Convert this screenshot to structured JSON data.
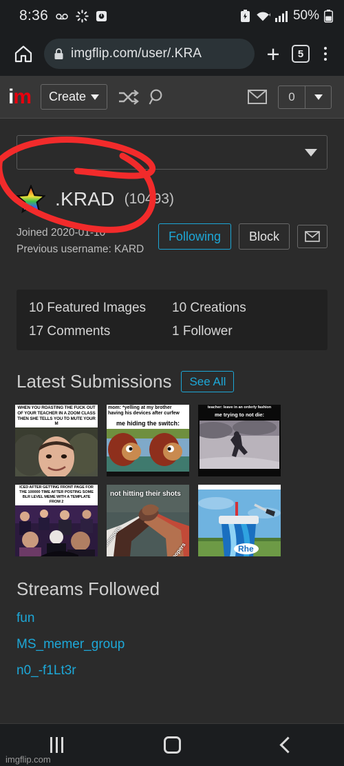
{
  "statusbar": {
    "time": "8:36",
    "battery_percent": "50%",
    "icons": [
      "voicemail-icon",
      "loading-spinner-icon",
      "screen-record-icon",
      "battery-saver-icon",
      "wifi-icon",
      "signal-icon",
      "battery-icon"
    ]
  },
  "browser": {
    "url_visible": "imgflip.com/user/.KRA",
    "url_domain": "imgflip.com",
    "url_path": "/user/.KRA",
    "tab_count": "5",
    "home_icon": "home-icon",
    "lock_icon": "lock-icon",
    "new_tab_icon": "plus-icon",
    "menu_icon": "kebab-menu-icon"
  },
  "site_header": {
    "logo_i": "i",
    "logo_m": "m",
    "create_label": "Create",
    "shuffle_icon": "shuffle-icon",
    "search_icon": "search-icon",
    "mail_icon": "envelope-icon",
    "notification_count": "0"
  },
  "profile": {
    "dropdown_value": "",
    "avatar_icon": "rainbow-star-avatar",
    "username": ".KRAD",
    "points": "(10493)",
    "joined": "Joined 2020-01-10",
    "previous_username": "Previous username: KARD",
    "following_label": "Following",
    "block_label": "Block",
    "message_icon": "envelope-icon"
  },
  "stats": [
    "10 Featured Images",
    "10 Creations",
    "17 Comments",
    "1 Follower"
  ],
  "submissions": {
    "title": "Latest Submissions",
    "see_all_label": "See All",
    "items": [
      {
        "name": "meme-zoom-class",
        "top_text": "WHEN YOU ROASTING THE FUCK OUT OF YOUR TEACHER IN A ZOOM CLASS THEN SHE TELLS YOU TO MUTE YOUR M",
        "bottom_text": "",
        "image_desc": "smirking-boy-red-shirt"
      },
      {
        "name": "meme-monkey-puppet",
        "top_text": "mom: *yelling at my brother having his devices after curfew",
        "bottom_text": "me hiding the switch:",
        "image_desc": "monkey-puppet-looking-away"
      },
      {
        "name": "meme-running-away",
        "top_text": "teacher: leave in an orderly fashion",
        "bottom_text": "me trying to not die:",
        "image_desc": "person-running-in-snow"
      },
      {
        "name": "meme-front-page",
        "top_text": "ICED AFTER GETTING FRONT PAGE FOR THE 100000 TIME AFTER POSTING SOME BLR LEVEL MEME WITH A TEMPLATE FROM 2",
        "bottom_text": "",
        "image_desc": "celebrity-audience-crowd"
      },
      {
        "name": "meme-epic-handshake",
        "top_text": "not hitting their shots",
        "bottom_text": "",
        "label_left": "simmons",
        "label_right": "stormtroopers",
        "image_desc": "epic-handshake-arms"
      },
      {
        "name": "meme-giant-cup",
        "top_text": "",
        "bottom_text": "",
        "image_desc": "giant-rhino-cup-statue"
      }
    ]
  },
  "streams": {
    "title": "Streams Followed",
    "items": [
      "fun",
      "MS_memer_group",
      "n0_-f1Lt3r"
    ]
  },
  "navbar": {
    "recents_icon": "recents-icon",
    "home_icon": "home-square-icon",
    "back_icon": "back-chevron-icon"
  },
  "footer": {
    "label": "imgflip.com"
  },
  "colors": {
    "accent_blue": "#1da8d8",
    "logo_red": "#e8000d",
    "page_bg": "#2b2b2b",
    "header_bg": "#373737",
    "chrome_bg": "#1b1d1f",
    "annotation_red": "#f22b2b"
  }
}
